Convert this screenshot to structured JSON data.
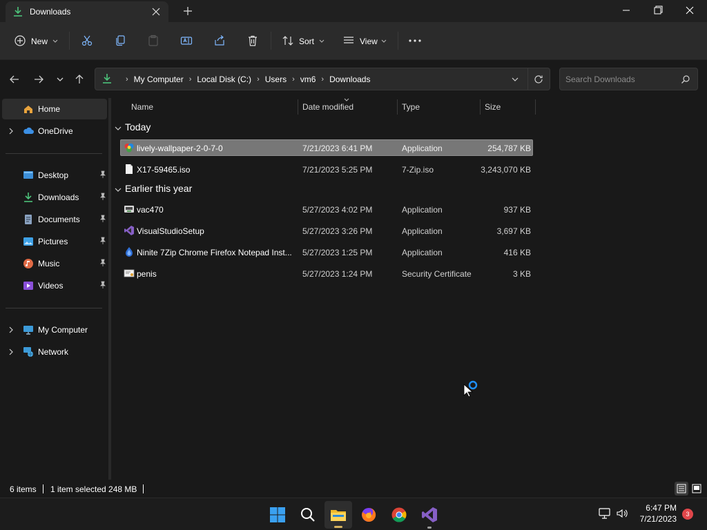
{
  "window": {
    "tab_title": "Downloads"
  },
  "command_bar": {
    "new_label": "New",
    "sort_label": "Sort",
    "view_label": "View"
  },
  "address": {
    "crumbs": [
      "My Computer",
      "Local Disk (C:)",
      "Users",
      "vm6",
      "Downloads"
    ],
    "search_placeholder": "Search Downloads"
  },
  "sidebar": {
    "home": "Home",
    "onedrive": "OneDrive",
    "desktop": "Desktop",
    "downloads": "Downloads",
    "documents": "Documents",
    "pictures": "Pictures",
    "music": "Music",
    "videos": "Videos",
    "my_computer": "My Computer",
    "network": "Network"
  },
  "columns": {
    "name": "Name",
    "date": "Date modified",
    "type": "Type",
    "size": "Size"
  },
  "groups": {
    "today": "Today",
    "earlier": "Earlier this year"
  },
  "files": [
    {
      "name": "lively-wallpaper-2-0-7-0",
      "date": "7/21/2023 6:41 PM",
      "type": "Application",
      "size": "254,787 KB",
      "icon": "lively-icon"
    },
    {
      "name": "X17-59465.iso",
      "date": "7/21/2023 5:25 PM",
      "type": "7-Zip.iso",
      "size": "3,243,070 KB",
      "icon": "file-icon"
    },
    {
      "name": "vac470",
      "date": "5/27/2023 4:02 PM",
      "type": "Application",
      "size": "937 KB",
      "icon": "installer-icon"
    },
    {
      "name": "VisualStudioSetup",
      "date": "5/27/2023 3:26 PM",
      "type": "Application",
      "size": "3,697 KB",
      "icon": "visual-studio-icon"
    },
    {
      "name": "Ninite 7Zip Chrome Firefox Notepad Inst...",
      "date": "5/27/2023 1:25 PM",
      "type": "Application",
      "size": "416 KB",
      "icon": "ninite-icon"
    },
    {
      "name": "penis",
      "date": "5/27/2023 1:24 PM",
      "type": "Security Certificate",
      "size": "3 KB",
      "icon": "certificate-icon"
    }
  ],
  "status": {
    "item_count": "6 items",
    "selection": "1 item selected  248 MB"
  },
  "tray": {
    "time": "6:47 PM",
    "date": "7/21/2023",
    "notifications": "3"
  },
  "colors": {
    "accent": "#0078d4",
    "selection": "#777777",
    "background": "#191919"
  }
}
